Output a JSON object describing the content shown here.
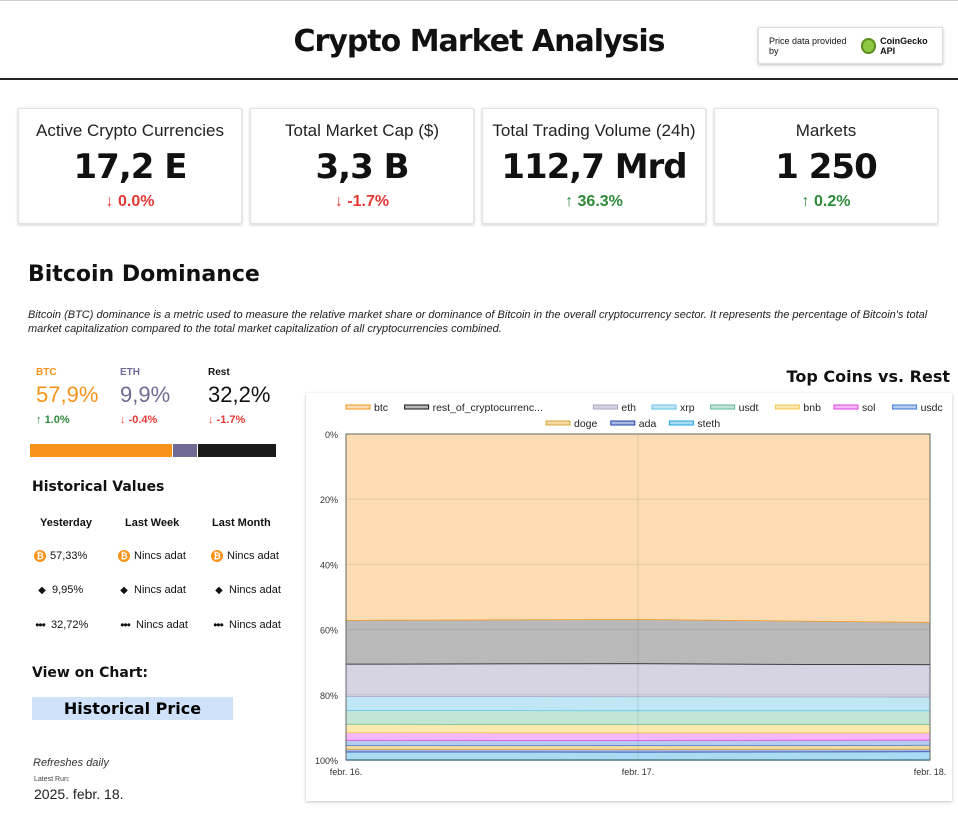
{
  "header": {
    "title": "Crypto Market Analysis",
    "provider_prefix": "Price data provided by",
    "provider_brand": "CoinGecko API"
  },
  "kpis": [
    {
      "label": "Active Crypto Currencies",
      "value": "17,2 E",
      "change": "0.0%",
      "direction": "down"
    },
    {
      "label": "Total Market Cap ($)",
      "value": "3,3 B",
      "change": "-1.7%",
      "direction": "down"
    },
    {
      "label": "Total Trading Volume (24h)",
      "value": "112,7 Mrd",
      "change": "36.3%",
      "direction": "up"
    },
    {
      "label": "Markets",
      "value": "1 250",
      "change": "0.2%",
      "direction": "up"
    }
  ],
  "dominance": {
    "title": "Bitcoin Dominance",
    "description": "Bitcoin (BTC) dominance is a metric used to measure the relative market share or dominance of Bitcoin in the overall cryptocurrency sector. It represents the percentage of Bitcoin's total market capitalization compared to the total market capitalization of all cryptocurrencies combined.",
    "columns": [
      {
        "label": "BTC",
        "value": "57,9%",
        "change": "1.0%",
        "direction": "up",
        "color": "#f7931a",
        "share": 57.9
      },
      {
        "label": "ETH",
        "value": "9,9%",
        "change": "-0.4%",
        "direction": "down",
        "color": "#716b94",
        "share": 9.9
      },
      {
        "label": "Rest",
        "value": "32,2%",
        "change": "-1.7%",
        "direction": "down",
        "color": "#1a1a1a",
        "share": 32.2
      }
    ]
  },
  "historical": {
    "title": "Historical Values",
    "headers": [
      "Yesterday",
      "Last Week",
      "Last Month"
    ],
    "rows": [
      {
        "icon": "bitcoin-icon",
        "values": [
          "57,33%",
          "Nincs adat",
          "Nincs adat"
        ]
      },
      {
        "icon": "ethereum-icon",
        "values": [
          "9,95%",
          "Nincs adat",
          "Nincs adat"
        ]
      },
      {
        "icon": "dots-icon",
        "values": [
          "32,72%",
          "Nincs adat",
          "Nincs adat"
        ]
      }
    ]
  },
  "view_chart": {
    "title": "View on Chart:",
    "button": "Historical Price"
  },
  "footer": {
    "refresh": "Refreshes daily",
    "last_run_label": "Latest Run:",
    "last_run": "2025. febr. 18."
  },
  "chart_data": {
    "type": "area",
    "title": "Top Coins vs. Rest",
    "x": [
      "febr. 16.",
      "febr. 17.",
      "febr. 18."
    ],
    "y_ticks": [
      "0%",
      "20%",
      "40%",
      "60%",
      "80%",
      "100%"
    ],
    "ylim": [
      0,
      100
    ],
    "y_inverted": true,
    "stacked": true,
    "legend_position": "top",
    "series": [
      {
        "name": "btc",
        "color": "#f7931a",
        "fill": "#fbdcb3",
        "values": [
          57.3,
          57.0,
          57.9
        ]
      },
      {
        "name": "rest_of_cryptocurrenc...",
        "color": "#111111",
        "fill": "#b9b9b9",
        "values": [
          13.4,
          13.6,
          13.0
        ]
      },
      {
        "name": "eth",
        "color": "#a9a4c4",
        "fill": "#d6d3e2",
        "values": [
          9.95,
          10.1,
          9.9
        ]
      },
      {
        "name": "xrp",
        "color": "#5fc3e8",
        "fill": "#bfe6f5",
        "values": [
          4.3,
          4.3,
          4.2
        ]
      },
      {
        "name": "usdt",
        "color": "#5fb89a",
        "fill": "#c2e5d6",
        "values": [
          4.2,
          4.2,
          4.2
        ]
      },
      {
        "name": "bnb",
        "color": "#f3c74b",
        "fill": "#fbe9b0",
        "values": [
          2.6,
          2.6,
          2.6
        ]
      },
      {
        "name": "sol",
        "color": "#e040e0",
        "fill": "#f6b8f6",
        "values": [
          2.3,
          2.3,
          2.2
        ]
      },
      {
        "name": "usdc",
        "color": "#3a77d4",
        "fill": "#b7cdf0",
        "values": [
          1.6,
          1.6,
          1.6
        ]
      },
      {
        "name": "doge",
        "color": "#d8a73a",
        "fill": "#f1d9a0",
        "values": [
          1.2,
          1.2,
          1.2
        ]
      },
      {
        "name": "ada",
        "color": "#1f3fa6",
        "fill": "#a8b6e0",
        "values": [
          0.8,
          0.8,
          0.8
        ]
      },
      {
        "name": "steth",
        "color": "#1ea5e0",
        "fill": "#a9dcf3",
        "values": [
          2.35,
          2.3,
          2.4
        ]
      }
    ]
  }
}
